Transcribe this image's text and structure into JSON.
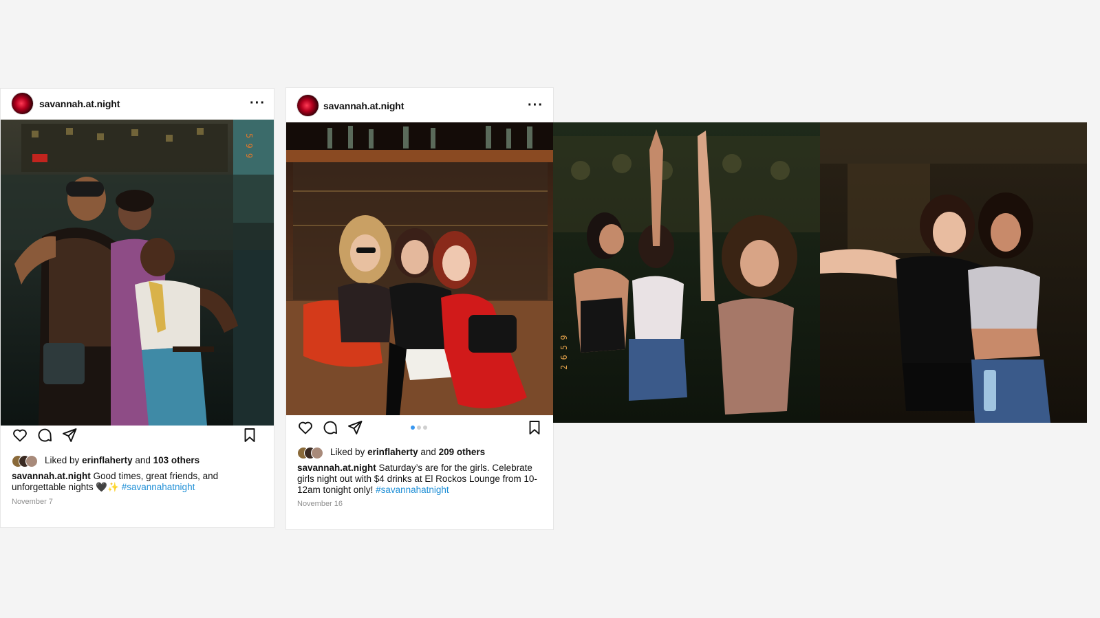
{
  "posts": [
    {
      "username": "savannah.at.night",
      "liked_by_prefix": "Liked by",
      "liked_by_user": "erinflaherty",
      "liked_by_and": "and",
      "liked_by_others": "103 others",
      "caption_user": "savannah.at.night",
      "caption_text": "Good times, great friends, and unforgettable nights 🖤✨",
      "hashtag": "#savannahatnight",
      "date": "November 7"
    },
    {
      "username": "savannah.at.night",
      "liked_by_prefix": "Liked by",
      "liked_by_user": "erinflaherty",
      "liked_by_and": "and",
      "liked_by_others": "209 others",
      "caption_user": "savannah.at.night",
      "caption_text": "Saturday’s are for the girls. Celebrate girls night out with $4 drinks at El Rockos Lounge from 10-12am tonight only!",
      "hashtag": "#savannahatnight",
      "date": "November 16",
      "carousel": {
        "count": 3,
        "active_index": 0
      }
    }
  ],
  "icons": {
    "like": "heart-icon",
    "comment": "comment-icon",
    "share": "paper-plane-icon",
    "save": "bookmark-icon",
    "more": "more-options-icon"
  },
  "colors": {
    "hashtag": "#1f8fd6",
    "carousel_active": "#3897f0",
    "date": "#8e8e8e"
  }
}
